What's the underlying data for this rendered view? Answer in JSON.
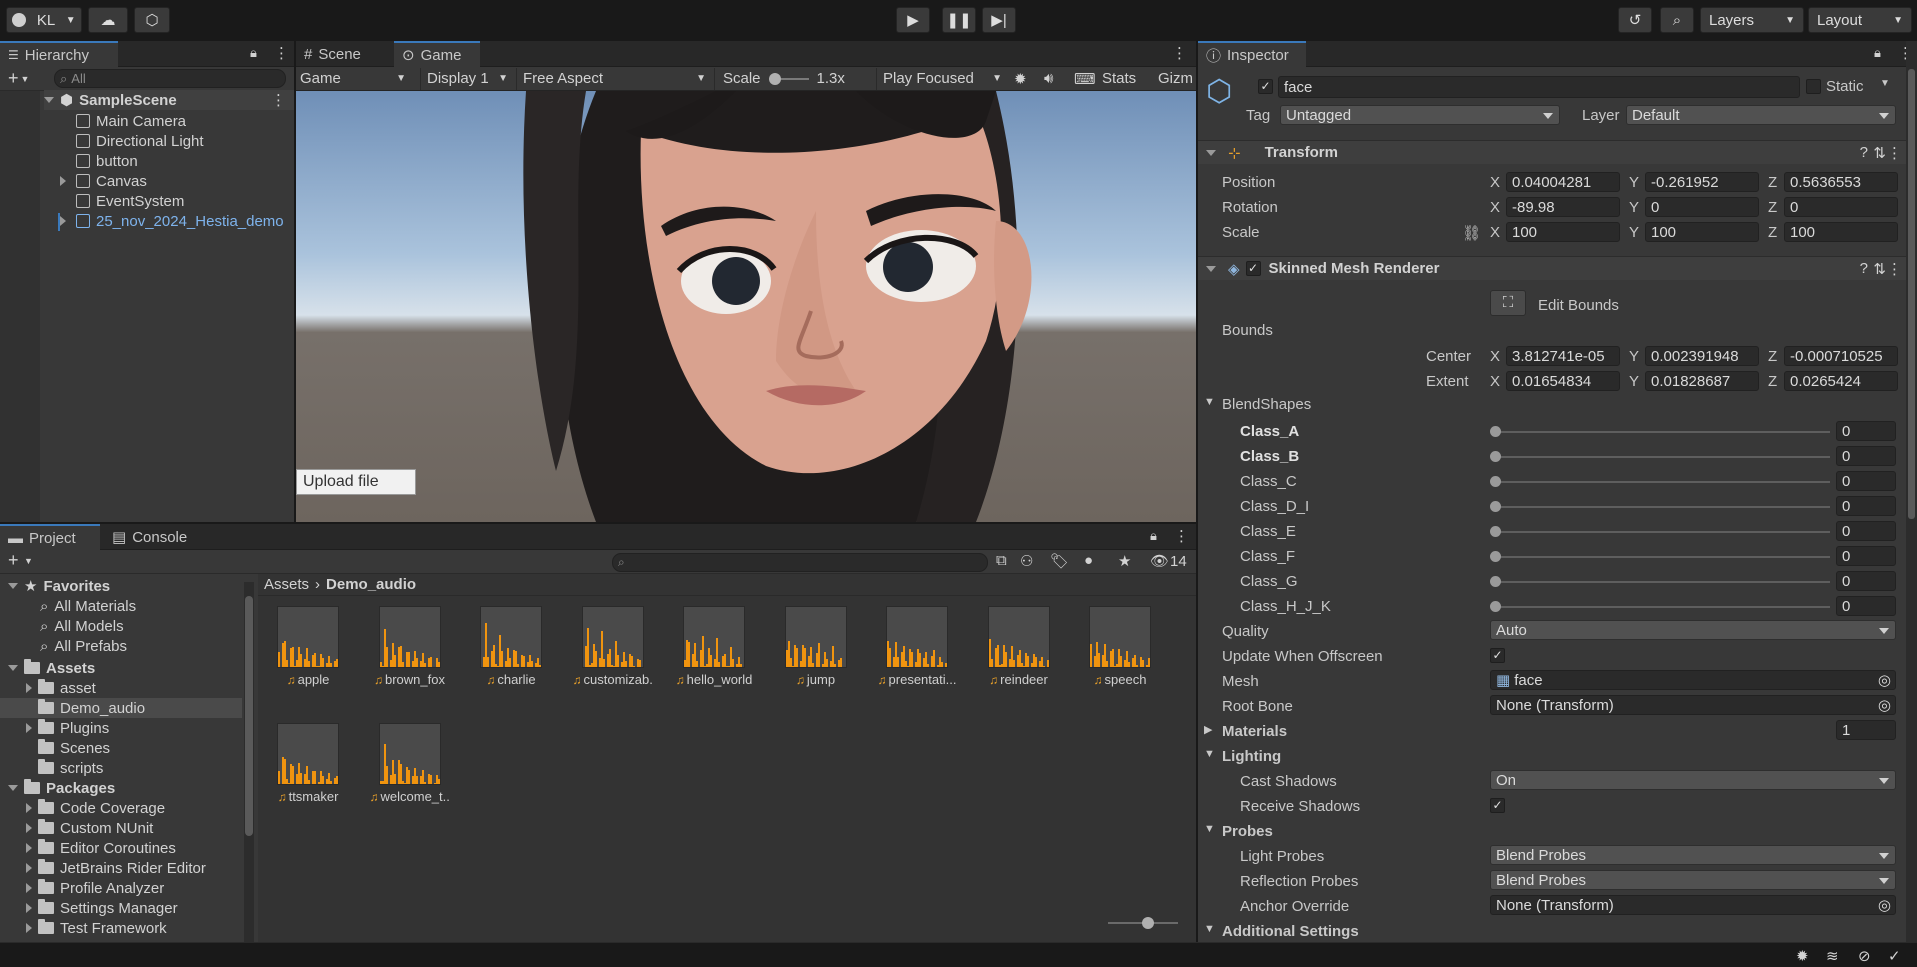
{
  "toolbar": {
    "account": "KL",
    "layers": "Layers",
    "layout": "Layout"
  },
  "hierarchy": {
    "tab": "Hierarchy",
    "search_placeholder": "All",
    "scene": "SampleScene",
    "items": [
      {
        "label": "Main Camera",
        "expand": false
      },
      {
        "label": "Directional Light",
        "expand": false
      },
      {
        "label": "button",
        "expand": false
      },
      {
        "label": "Canvas",
        "expand": true
      },
      {
        "label": "EventSystem",
        "expand": false
      },
      {
        "label": "25_nov_2024_Hestia_demo",
        "expand": true
      }
    ]
  },
  "viewport": {
    "tabs": [
      "Scene",
      "Game"
    ],
    "game_dropdown": "Game",
    "display": "Display 1",
    "aspect": "Free Aspect",
    "scale_label": "Scale",
    "scale_value": "1.3x",
    "play_mode": "Play Focused",
    "stats": "Stats",
    "gizmos": "Gizm",
    "upload_button": "Upload file"
  },
  "project": {
    "tabs": [
      "Project",
      "Console"
    ],
    "hidden_count": "14",
    "breadcrumb": [
      "Assets",
      "Demo_audio"
    ],
    "favorites_label": "Favorites",
    "favorites": [
      "All Materials",
      "All Models",
      "All Prefabs"
    ],
    "assets_label": "Assets",
    "assets_folders": [
      "asset",
      "Demo_audio",
      "Plugins",
      "Scenes",
      "scripts"
    ],
    "packages_label": "Packages",
    "packages": [
      "Code Coverage",
      "Custom NUnit",
      "Editor Coroutines",
      "JetBrains Rider Editor",
      "Profile Analyzer",
      "Settings Manager",
      "Test Framework"
    ],
    "audio_files": [
      "apple",
      "brown_fox",
      "charlie",
      "customizab...",
      "hello_world",
      "jump",
      "presentati...",
      "reindeer",
      "speech",
      "ttsmaker",
      "welcome_t..."
    ]
  },
  "inspector": {
    "tab": "Inspector",
    "object_name": "face",
    "static_label": "Static",
    "tag_label": "Tag",
    "tag_value": "Untagged",
    "layer_label": "Layer",
    "layer_value": "Default",
    "transform": {
      "title": "Transform",
      "position_label": "Position",
      "rotation_label": "Rotation",
      "scale_label": "Scale",
      "position": [
        "0.04004281",
        "-0.261952",
        "0.5636553"
      ],
      "rotation": [
        "-89.98",
        "0",
        "0"
      ],
      "scale": [
        "100",
        "100",
        "100"
      ]
    },
    "smr": {
      "title": "Skinned Mesh Renderer",
      "edit_bounds": "Edit Bounds",
      "bounds_label": "Bounds",
      "center_label": "Center",
      "extent_label": "Extent",
      "center": [
        "3.812741e-05",
        "0.002391948",
        "-0.000710525"
      ],
      "extent": [
        "0.01654834",
        "0.01828687",
        "0.0265424"
      ],
      "blendshapes_label": "BlendShapes",
      "blendshapes": [
        {
          "name": "Class_A",
          "value": "0"
        },
        {
          "name": "Class_B",
          "value": "0"
        },
        {
          "name": "Class_C",
          "value": "0"
        },
        {
          "name": "Class_D_I",
          "value": "0"
        },
        {
          "name": "Class_E",
          "value": "0"
        },
        {
          "name": "Class_F",
          "value": "0"
        },
        {
          "name": "Class_G",
          "value": "0"
        },
        {
          "name": "Class_H_J_K",
          "value": "0"
        }
      ],
      "quality_label": "Quality",
      "quality_value": "Auto",
      "offscreen_label": "Update When Offscreen",
      "mesh_label": "Mesh",
      "mesh_value": "face",
      "rootbone_label": "Root Bone",
      "rootbone_value": "None (Transform)",
      "materials_label": "Materials",
      "materials_count": "1",
      "lighting_label": "Lighting",
      "cast_label": "Cast Shadows",
      "cast_value": "On",
      "receive_label": "Receive Shadows",
      "probes_label": "Probes",
      "light_probes_label": "Light Probes",
      "light_probes_value": "Blend Probes",
      "refl_label": "Reflection Probes",
      "refl_value": "Blend Probes",
      "anchor_label": "Anchor Override",
      "anchor_value": "None (Transform)",
      "additional_label": "Additional Settings"
    }
  },
  "colors": {
    "accent": "#3a79bb",
    "audio_wave": "#f0940f",
    "link_blue": "#7eb3ec"
  }
}
